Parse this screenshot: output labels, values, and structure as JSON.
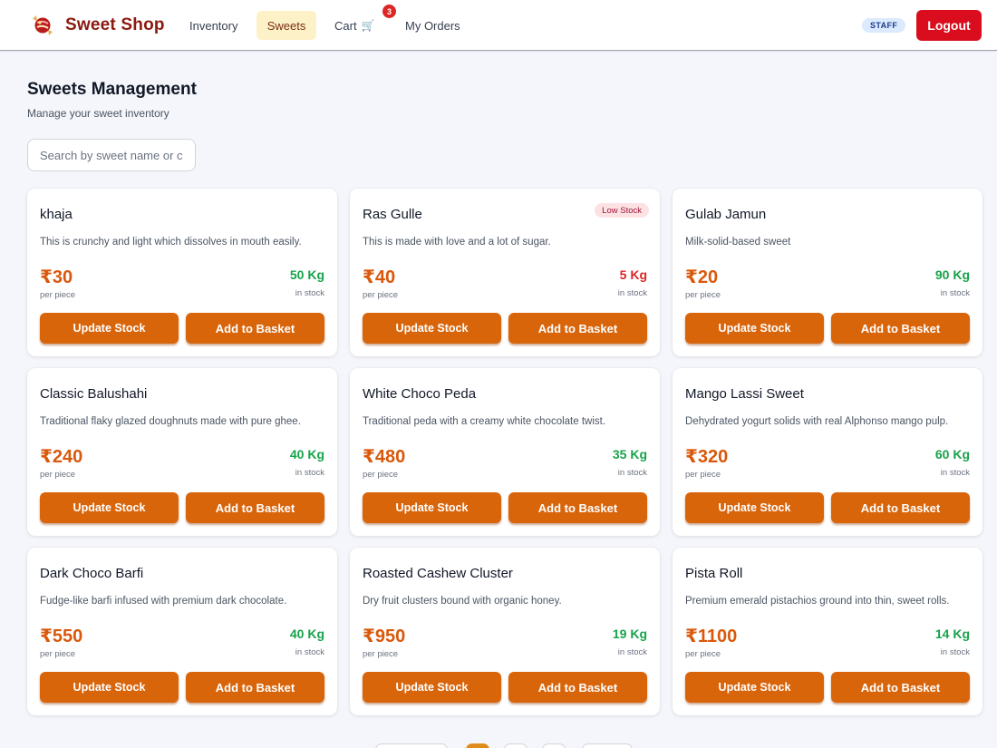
{
  "app": {
    "title": "Sweet Shop"
  },
  "nav": {
    "items": [
      {
        "label": "Inventory"
      },
      {
        "label": "Sweets",
        "active": true
      },
      {
        "label": "Cart"
      },
      {
        "label": "My Orders"
      }
    ],
    "cart_count": "3",
    "cart_icon": "cart-icon"
  },
  "user": {
    "role": "STAFF",
    "logout_label": "Logout"
  },
  "page": {
    "title": "Sweets Management",
    "subtitle": "Manage your sweet inventory"
  },
  "search": {
    "placeholder": "Search by sweet name or category"
  },
  "labels": {
    "per_piece": "per piece",
    "in_stock": "in stock",
    "update_stock": "Update Stock",
    "add_to_basket": "Add to Basket",
    "low_stock": "Low Stock"
  },
  "colors": {
    "brand": "#8b1a10",
    "accent": "#d9650b",
    "price": "#d9580b",
    "stock_ok": "#16a34a",
    "stock_low": "#dc2626",
    "logout": "#d90d1d"
  },
  "sweets": [
    {
      "name": "khaja",
      "description": "This is crunchy and light which dissolves in mouth easily.",
      "price": "₹30",
      "stock": "50 Kg",
      "low_stock": false
    },
    {
      "name": "Ras Gulle",
      "description": "This is made with love and a lot of sugar.",
      "price": "₹40",
      "stock": "5 Kg",
      "low_stock": true
    },
    {
      "name": "Gulab Jamun",
      "description": "Milk-solid-based sweet",
      "price": "₹20",
      "stock": "90 Kg",
      "low_stock": false
    },
    {
      "name": "Classic Balushahi",
      "description": "Traditional flaky glazed doughnuts made with pure ghee.",
      "price": "₹240",
      "stock": "40 Kg",
      "low_stock": false
    },
    {
      "name": "White Choco Peda",
      "description": "Traditional peda with a creamy white chocolate twist.",
      "price": "₹480",
      "stock": "35 Kg",
      "low_stock": false
    },
    {
      "name": "Mango Lassi Sweet",
      "description": "Dehydrated yogurt solids with real Alphonso mango pulp.",
      "price": "₹320",
      "stock": "60 Kg",
      "low_stock": false
    },
    {
      "name": "Dark Choco Barfi",
      "description": "Fudge-like barfi infused with premium dark chocolate.",
      "price": "₹550",
      "stock": "40 Kg",
      "low_stock": false
    },
    {
      "name": "Roasted Cashew Cluster",
      "description": "Dry fruit clusters bound with organic honey.",
      "price": "₹950",
      "stock": "19 Kg",
      "low_stock": false
    },
    {
      "name": "Pista Roll",
      "description": "Premium emerald pistachios ground into thin, sweet rolls.",
      "price": "₹1100",
      "stock": "14 Kg",
      "low_stock": false
    }
  ]
}
